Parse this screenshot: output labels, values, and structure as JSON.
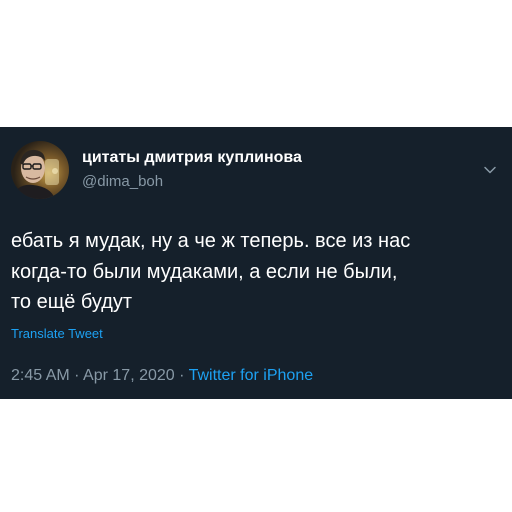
{
  "tweet": {
    "display_name": "цитаты дмитрия куплинова",
    "handle": "@dima_boh",
    "text": "ебать я мудак, ну а че ж теперь. все из нас\nкогда-то были мудаками, а если не были,\nто ещё будут",
    "translate_label": "Translate Tweet",
    "time": "2:45 AM",
    "separator": " · ",
    "date": "Apr 17, 2020",
    "source": "Twitter for iPhone"
  },
  "icons": {
    "avatar": "profile-photo",
    "menu": "chevron-down-icon"
  },
  "colors": {
    "card_background": "#15202b",
    "text_primary": "#ffffff",
    "text_secondary": "#8899a6",
    "accent": "#1da1f2",
    "page_background": "#ffffff"
  }
}
